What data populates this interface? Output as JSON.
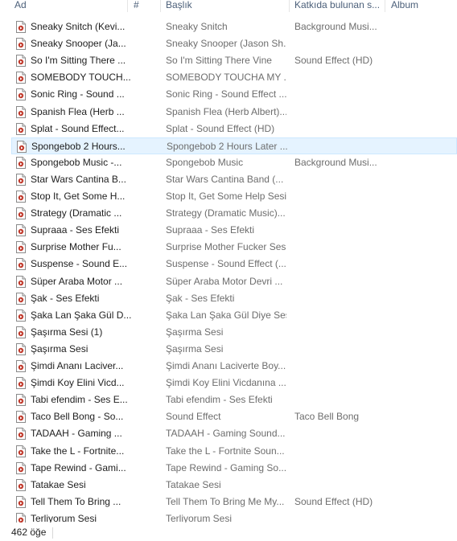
{
  "columns": {
    "name": "Ad",
    "number": "#",
    "title": "Başlık",
    "contributing_artists": "Katkıda bulunan s...",
    "album": "Album"
  },
  "files": [
    {
      "name": "Sneaky Snitch (Kevi...",
      "title": "Sneaky Snitch",
      "artist": "Background Musi...",
      "selected": false,
      "icon": "media-file-icon"
    },
    {
      "name": "Sneaky Snooper (Ja...",
      "title": "Sneaky Snooper (Jason Sh...",
      "artist": "",
      "selected": false,
      "icon": "media-file-icon"
    },
    {
      "name": "So I'm Sitting There ...",
      "title": "So I'm Sitting There Vine",
      "artist": "Sound Effect (HD)",
      "selected": false,
      "icon": "media-file-icon"
    },
    {
      "name": "SOMEBODY TOUCH...",
      "title": "SOMEBODY TOUCHA MY ...",
      "artist": "",
      "selected": false,
      "icon": "media-file-icon"
    },
    {
      "name": "Sonic Ring - Sound ...",
      "title": "Sonic Ring - Sound Effect ...",
      "artist": "",
      "selected": false,
      "icon": "media-file-icon"
    },
    {
      "name": "Spanish Flea (Herb ...",
      "title": "Spanish Flea (Herb Albert)...",
      "artist": "",
      "selected": false,
      "icon": "media-file-icon"
    },
    {
      "name": "Splat - Sound Effect...",
      "title": "Splat - Sound Effect (HD)",
      "artist": "",
      "selected": false,
      "icon": "media-file-icon"
    },
    {
      "name": "Spongebob 2 Hours...",
      "title": "Spongebob 2 Hours Later ...",
      "artist": "",
      "selected": true,
      "icon": "media-file-icon"
    },
    {
      "name": "Spongebob Music -...",
      "title": "Spongebob Music",
      "artist": "Background Musi...",
      "selected": false,
      "icon": "media-file-icon"
    },
    {
      "name": "Star Wars Cantina B...",
      "title": "Star Wars Cantina Band (...",
      "artist": "",
      "selected": false,
      "icon": "media-file-icon"
    },
    {
      "name": "Stop It, Get Some H...",
      "title": "Stop It, Get Some Help Sesi",
      "artist": "",
      "selected": false,
      "icon": "media-file-icon"
    },
    {
      "name": "Strategy (Dramatic ...",
      "title": "Strategy (Dramatic Music)...",
      "artist": "",
      "selected": false,
      "icon": "media-file-icon"
    },
    {
      "name": "Supraaa - Ses Efekti",
      "title": "Supraaa - Ses Efekti",
      "artist": "",
      "selected": false,
      "icon": "media-file-icon"
    },
    {
      "name": "Surprise Mother Fu...",
      "title": "Surprise Mother Fucker Sesi",
      "artist": "",
      "selected": false,
      "icon": "media-file-icon"
    },
    {
      "name": "Suspense - Sound E...",
      "title": "Suspense - Sound Effect (...",
      "artist": "",
      "selected": false,
      "icon": "media-file-icon"
    },
    {
      "name": "Süper Araba Motor ...",
      "title": "Süper Araba Motor Devri ...",
      "artist": "",
      "selected": false,
      "icon": "media-file-icon"
    },
    {
      "name": "Şak - Ses Efekti",
      "title": "Şak - Ses Efekti",
      "artist": "",
      "selected": false,
      "icon": "media-file-icon"
    },
    {
      "name": "Şaka Lan Şaka Gül D...",
      "title": "Şaka Lan Şaka Gül Diye Sesi",
      "artist": "",
      "selected": false,
      "icon": "media-file-icon"
    },
    {
      "name": "Şaşırma Sesi (1)",
      "title": "Şaşırma Sesi",
      "artist": "",
      "selected": false,
      "icon": "media-file-icon"
    },
    {
      "name": "Şaşırma Sesi",
      "title": "Şaşırma Sesi",
      "artist": "",
      "selected": false,
      "icon": "media-file-icon"
    },
    {
      "name": "Şimdi Ananı Laciver...",
      "title": "Şimdi Ananı Laciverte Boy...",
      "artist": "",
      "selected": false,
      "icon": "media-file-icon"
    },
    {
      "name": "Şimdi Koy Elini Vicd...",
      "title": "Şimdi Koy Elini Vicdanına ...",
      "artist": "",
      "selected": false,
      "icon": "media-file-icon"
    },
    {
      "name": "Tabi efendim - Ses E...",
      "title": "Tabi efendim - Ses Efekti",
      "artist": "",
      "selected": false,
      "icon": "media-file-icon"
    },
    {
      "name": "Taco Bell Bong - So...",
      "title": "Sound Effect",
      "artist": "Taco Bell Bong",
      "selected": false,
      "icon": "media-file-icon"
    },
    {
      "name": "TADAAH - Gaming ...",
      "title": "TADAAH - Gaming Sound...",
      "artist": "",
      "selected": false,
      "icon": "media-file-icon"
    },
    {
      "name": "Take the L - Fortnite...",
      "title": "Take the L - Fortnite Soun...",
      "artist": "",
      "selected": false,
      "icon": "media-file-icon"
    },
    {
      "name": "Tape Rewind - Gami...",
      "title": "Tape Rewind - Gaming So...",
      "artist": "",
      "selected": false,
      "icon": "media-file-icon"
    },
    {
      "name": "Tatakae Sesi",
      "title": "Tatakae Sesi",
      "artist": "",
      "selected": false,
      "icon": "media-file-icon"
    },
    {
      "name": "Tell Them To Bring ...",
      "title": "Tell Them To Bring Me My...",
      "artist": "Sound Effect (HD)",
      "selected": false,
      "icon": "media-file-icon"
    },
    {
      "name": "Terliyorum Sesi",
      "title": "Terliyorum Sesi",
      "artist": "",
      "selected": false,
      "icon": "media-file-icon"
    }
  ],
  "status": {
    "item_count": "462 öğe"
  },
  "colors": {
    "selection_fill": "#e5f3ff",
    "selection_border": "#cce8ff",
    "header_text": "#4c607a",
    "secondary_text": "#6d6d6d",
    "icon_accent": "#c0392b"
  }
}
